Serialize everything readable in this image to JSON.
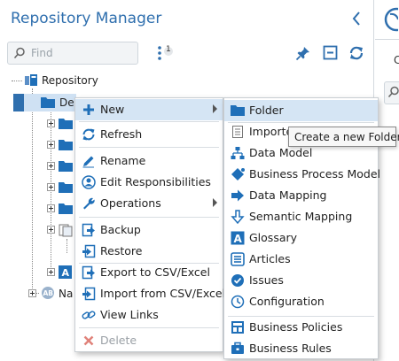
{
  "header": {
    "title": "Repository Manager"
  },
  "search": {
    "placeholder": "Find"
  },
  "filter": {
    "badge": "1"
  },
  "tree": {
    "root_label": "Repository",
    "items": [
      {
        "label": "De",
        "selected": true
      },
      {
        "label": "Na"
      }
    ]
  },
  "right_panel": {
    "letter": "C"
  },
  "context_menu": {
    "items": [
      {
        "label": "New",
        "icon": "plus-icon",
        "submenu": true
      },
      {
        "label": "Refresh",
        "icon": "refresh-icon"
      },
      {
        "label": "Rename",
        "icon": "pencil-icon"
      },
      {
        "label": "Edit Responsibilities",
        "icon": "person-icon"
      },
      {
        "label": "Operations",
        "icon": "wrench-icon",
        "submenu": true
      },
      {
        "label": "Backup",
        "icon": "backup-icon"
      },
      {
        "label": "Restore",
        "icon": "restore-icon"
      },
      {
        "label": "Export to CSV/Excel",
        "icon": "export-icon"
      },
      {
        "label": "Import from CSV/Excel",
        "icon": "import-icon"
      },
      {
        "label": "View Links",
        "icon": "link-icon"
      },
      {
        "label": "Delete",
        "icon": "delete-icon",
        "disabled": true
      }
    ]
  },
  "submenu": {
    "items": [
      {
        "label": "Folder",
        "icon": "folder-icon"
      },
      {
        "label": "Importe",
        "icon": "document-icon"
      },
      {
        "label": "Data Model",
        "icon": "data-model-icon"
      },
      {
        "label": "Business Process Model",
        "icon": "process-icon"
      },
      {
        "label": "Data Mapping",
        "icon": "mapping-icon"
      },
      {
        "label": "Semantic Mapping",
        "icon": "semantic-mapping-icon"
      },
      {
        "label": "Glossary",
        "icon": "glossary-icon"
      },
      {
        "label": "Articles",
        "icon": "articles-icon"
      },
      {
        "label": "Issues",
        "icon": "issues-icon"
      },
      {
        "label": "Configuration",
        "icon": "configuration-icon"
      },
      {
        "label": "Business Policies",
        "icon": "policies-icon"
      },
      {
        "label": "Business Rules",
        "icon": "rules-icon"
      }
    ]
  },
  "tooltip": {
    "text": "Create a new Folder"
  },
  "colors": {
    "accent": "#2f6fae",
    "icon_blue": "#1f6fb8",
    "highlight": "#d5e5f4",
    "delete_red": "#e0827a"
  }
}
